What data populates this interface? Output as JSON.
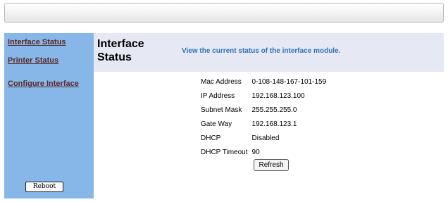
{
  "sidebar": {
    "links": [
      {
        "label": "Interface Status"
      },
      {
        "label": "Printer Status"
      },
      {
        "label": "Configure Interface"
      }
    ],
    "reboot_label": "Reboot"
  },
  "header": {
    "title": "Interface Status",
    "description": "View the current status of the interface module."
  },
  "status": {
    "rows": [
      {
        "label": "Mac Address",
        "value": "0-108-148-167-101-159"
      },
      {
        "label": "IP Address",
        "value": "192.168.123.100"
      },
      {
        "label": "Subnet Mask",
        "value": "255.255.255.0"
      },
      {
        "label": "Gate Way",
        "value": "192.168.123.1"
      },
      {
        "label": "DHCP",
        "value": "Disabled"
      },
      {
        "label": "DHCP Timeout",
        "value": "90"
      }
    ],
    "refresh_label": "Refresh"
  },
  "colors": {
    "sidebar_bg": "#87b7e8",
    "header_bg": "#e6e8f4",
    "link": "#5a2828",
    "description": "#2f74b6"
  }
}
